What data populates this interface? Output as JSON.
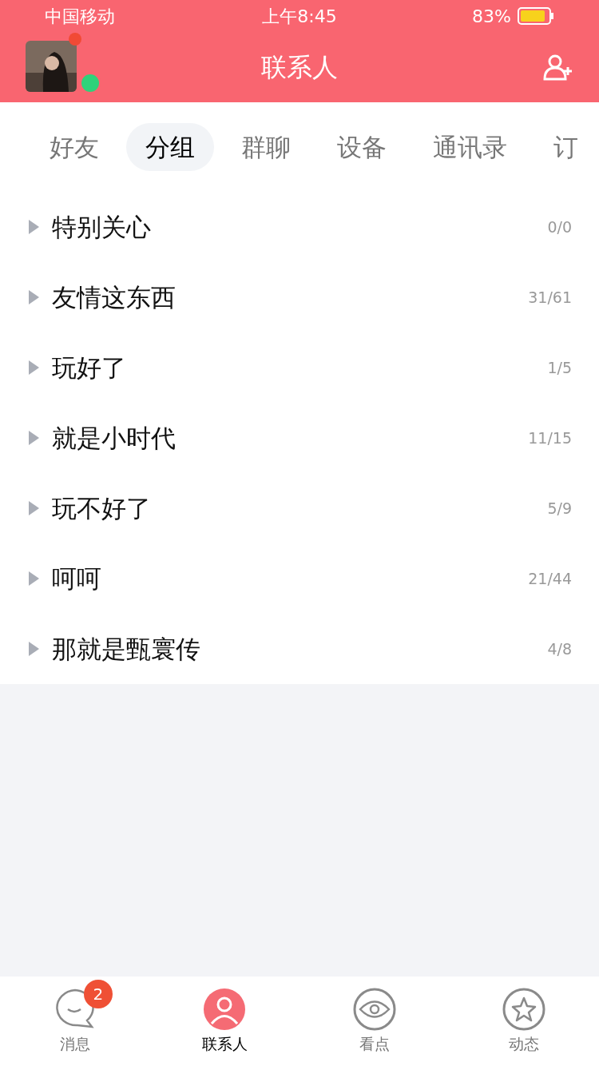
{
  "status_bar": {
    "carrier": "中国移动",
    "time": "上午8:45",
    "battery": "83%"
  },
  "header": {
    "title": "联系人",
    "avatar": {
      "unread_dot": true,
      "online": true
    }
  },
  "tabs": [
    {
      "label": "好友",
      "selected": false
    },
    {
      "label": "分组",
      "selected": true
    },
    {
      "label": "群聊",
      "selected": false
    },
    {
      "label": "设备",
      "selected": false
    },
    {
      "label": "通讯录",
      "selected": false
    },
    {
      "label": "订",
      "selected": false
    }
  ],
  "groups": [
    {
      "name": "特别关心",
      "count": "0/0",
      "expanded": false
    },
    {
      "name": "友情这东西",
      "count": "31/61",
      "expanded": false
    },
    {
      "name": "玩好了",
      "count": "1/5",
      "expanded": false
    },
    {
      "name": "就是小时代",
      "count": "11/15",
      "expanded": false
    },
    {
      "name": "玩不好了",
      "count": "5/9",
      "expanded": false
    },
    {
      "name": "呵呵",
      "count": "21/44",
      "expanded": false
    },
    {
      "name": "那就是甄寰传",
      "count": "4/8",
      "expanded": false
    }
  ],
  "bottom_nav": [
    {
      "kind": "messages",
      "label": "消息",
      "badge": "2",
      "selected": false
    },
    {
      "kind": "contacts",
      "label": "联系人",
      "selected": true
    },
    {
      "kind": "watch",
      "label": "看点",
      "selected": false
    },
    {
      "kind": "feed",
      "label": "动态",
      "selected": false
    }
  ]
}
